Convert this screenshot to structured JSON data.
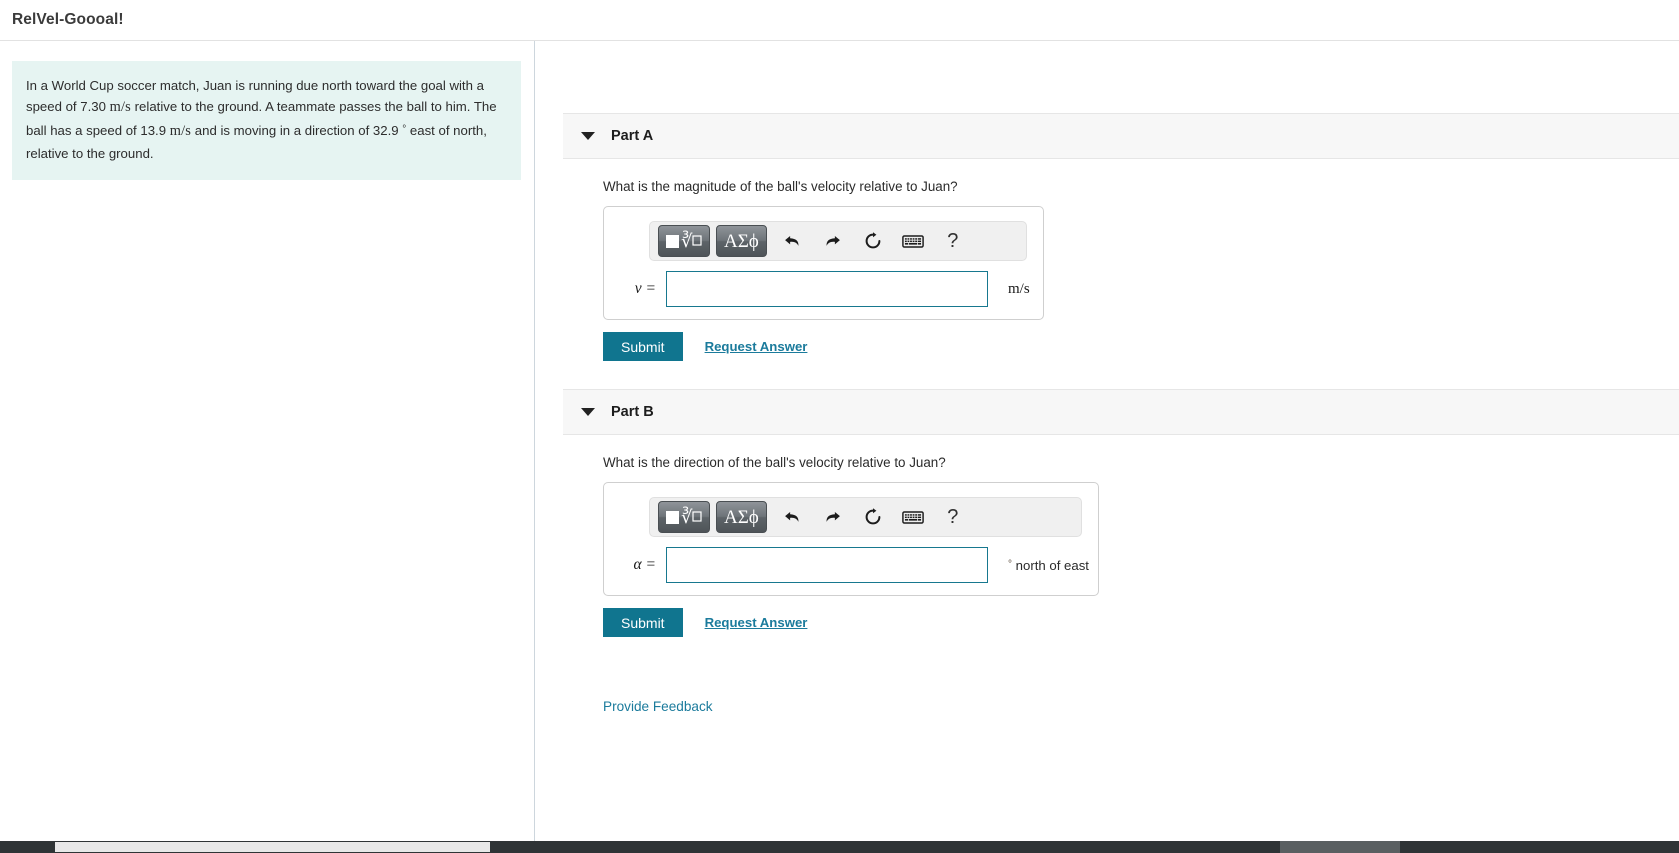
{
  "window": {
    "title": "RelVel-Goooal!"
  },
  "problem": {
    "text_part1": "In a World Cup soccer match, Juan is running due north toward the goal with a speed of 7.30 ",
    "unit1": "m/s",
    "text_part2": " relative to the ground. A teammate passes the ball to him. The ball has a speed of 13.9 ",
    "unit2": "m/s",
    "text_part3": " and is moving in a direction of 32.9 ",
    "degree": "°",
    "text_part4": " east of north, relative to the ground.",
    "speed_juan": "7.30",
    "speed_ball": "13.9",
    "direction_deg": "32.9",
    "background_color": "#e6f4f2"
  },
  "toolbar": {
    "sqrt_button_label": "√",
    "greek_button_label": "ΑΣϕ",
    "undo_title": "undo",
    "redo_title": "redo",
    "reset_title": "reset",
    "keyboard_title": "keyboard",
    "help_label": "?"
  },
  "parts": [
    {
      "label": "Part A",
      "question": "What is the magnitude of the ball's velocity relative to Juan?",
      "variable": "v =",
      "value": "",
      "placeholder": "",
      "unit": "m/s",
      "submit_label": "Submit",
      "request_label": "Request Answer"
    },
    {
      "label": "Part B",
      "question": "What is the direction of the ball's velocity relative to Juan?",
      "variable": "α =",
      "value": "",
      "placeholder": "",
      "unit_degree": "°",
      "unit_text": " north of east",
      "submit_label": "Submit",
      "request_label": "Request Answer"
    }
  ],
  "footer": {
    "feedback_label": "Provide Feedback"
  },
  "colors": {
    "accent": "#10758f",
    "link": "#1b7b9c",
    "input_border": "#17788f",
    "panel": "#f7f7f7"
  }
}
